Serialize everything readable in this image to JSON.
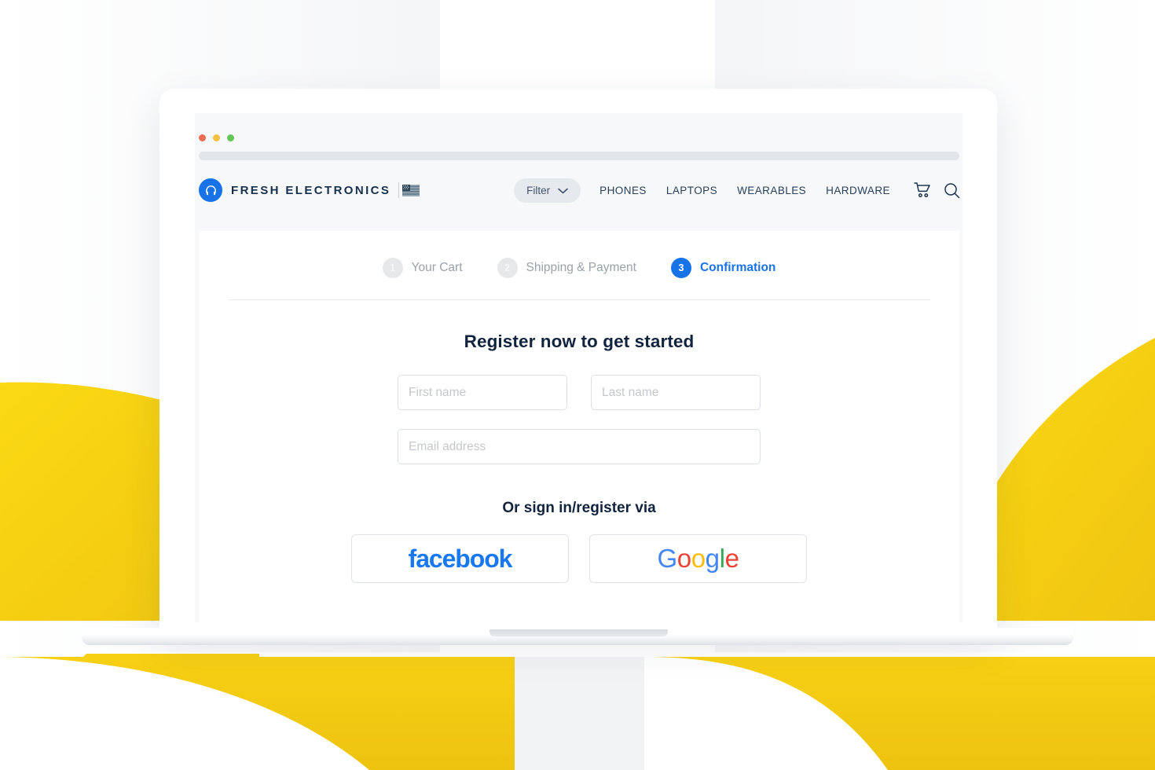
{
  "browser": {
    "window_controls": [
      "close",
      "minimize",
      "maximize"
    ],
    "url_placeholder": ""
  },
  "site_header": {
    "logo_icon": "headphones-icon",
    "brand_name": "FRESH ELECTRONICS",
    "locale_flag": "us-flag-icon",
    "filter": {
      "label": "Filter",
      "chevron_icon": "chevron-down-icon"
    },
    "nav_links": [
      {
        "label": "PHONES"
      },
      {
        "label": "LAPTOPS"
      },
      {
        "label": "WEARABLES"
      },
      {
        "label": "HARDWARE"
      }
    ],
    "icons": [
      {
        "name": "cart-icon"
      },
      {
        "name": "search-icon"
      }
    ]
  },
  "checkout": {
    "steps": [
      {
        "number": "1",
        "label": "Your Cart",
        "active": false
      },
      {
        "number": "2",
        "label": "Shipping & Payment",
        "active": false
      },
      {
        "number": "3",
        "label": "Confirmation",
        "active": true
      }
    ],
    "form_title": "Register now to get started",
    "fields": {
      "first_name": {
        "placeholder": "First name",
        "value": ""
      },
      "last_name": {
        "placeholder": "Last name",
        "value": ""
      },
      "email": {
        "placeholder": "Email address",
        "value": ""
      }
    },
    "social_title": "Or sign in/register via",
    "social_buttons": [
      {
        "id": "facebook",
        "label": "facebook"
      },
      {
        "id": "google",
        "label": "Google"
      }
    ]
  },
  "colors": {
    "brand_blue": "#1873e8",
    "active_blue": "#1a73e8",
    "facebook_blue": "#1877f2",
    "google_blue": "#4285f4",
    "google_red": "#ea4335",
    "google_yellow": "#fbbc05",
    "google_green": "#34a853",
    "accent_yellow": "#f6cf16",
    "navy_text": "#12243d"
  }
}
